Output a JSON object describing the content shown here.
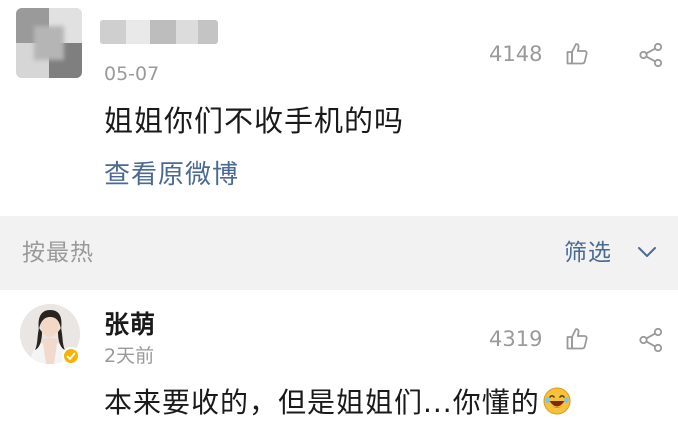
{
  "post": {
    "date": "05-07",
    "like_count": "4148",
    "text": "姐姐你们不收手机的吗",
    "link": "查看原微博"
  },
  "sort_bar": {
    "sort_label": "按最热",
    "filter_label": "筛选"
  },
  "comment": {
    "author": "张萌",
    "time": "2天前",
    "like_count": "4319",
    "text": "本来要收的，但是姐姐们...你懂的"
  },
  "icons": {
    "like": "thumbs-up-icon",
    "share": "share-icon",
    "chevron": "chevron-down-icon",
    "verified": "verified-badge-icon",
    "emoji": "laughing-emoji-icon"
  },
  "colors": {
    "link": "#4a6a93",
    "muted": "#9a9a9a",
    "text": "#1a1a1a",
    "separator_bg": "#f2f2f2",
    "badge": "#f5b400"
  }
}
